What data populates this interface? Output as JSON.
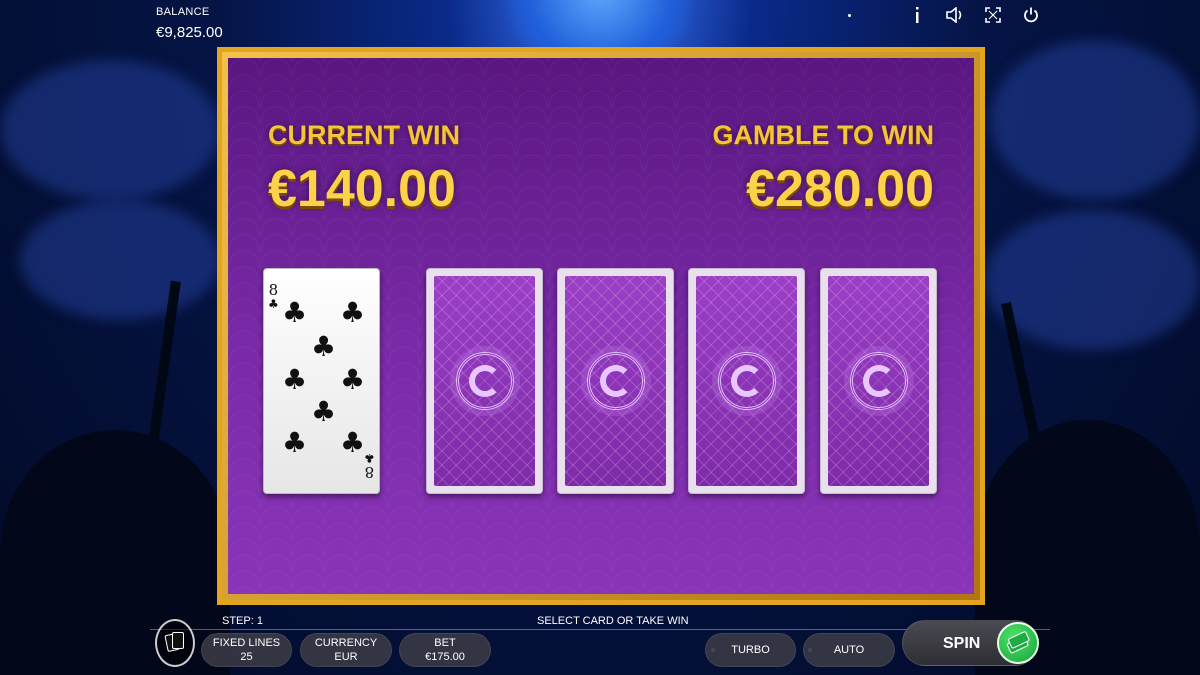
{
  "balance": {
    "label": "BALANCE",
    "value": "€9,825.00"
  },
  "top_icons": [
    "info-icon",
    "sound-icon",
    "fullscreen-icon",
    "power-icon"
  ],
  "gamble": {
    "current_win_label": "CURRENT WIN",
    "current_win_value": "€140.00",
    "gamble_to_win_label": "GAMBLE TO WIN",
    "gamble_to_win_value": "€280.00",
    "dealer_card": {
      "rank": "8",
      "suit": "♣"
    },
    "face_down_cards": 4
  },
  "status": {
    "step": "STEP: 1",
    "prompt": "SELECT CARD OR TAKE WIN"
  },
  "controls": {
    "fixed_lines": {
      "label": "FIXED LINES",
      "value": "25"
    },
    "currency": {
      "label": "CURRENCY",
      "value": "EUR"
    },
    "bet": {
      "label": "BET",
      "value": "€175.00"
    },
    "turbo": "TURBO",
    "auto": "AUTO",
    "spin": "SPIN"
  },
  "colors": {
    "gold": "#f6c43a",
    "panel_purple": "#7a2aa8",
    "spin_green": "#17a33a"
  }
}
